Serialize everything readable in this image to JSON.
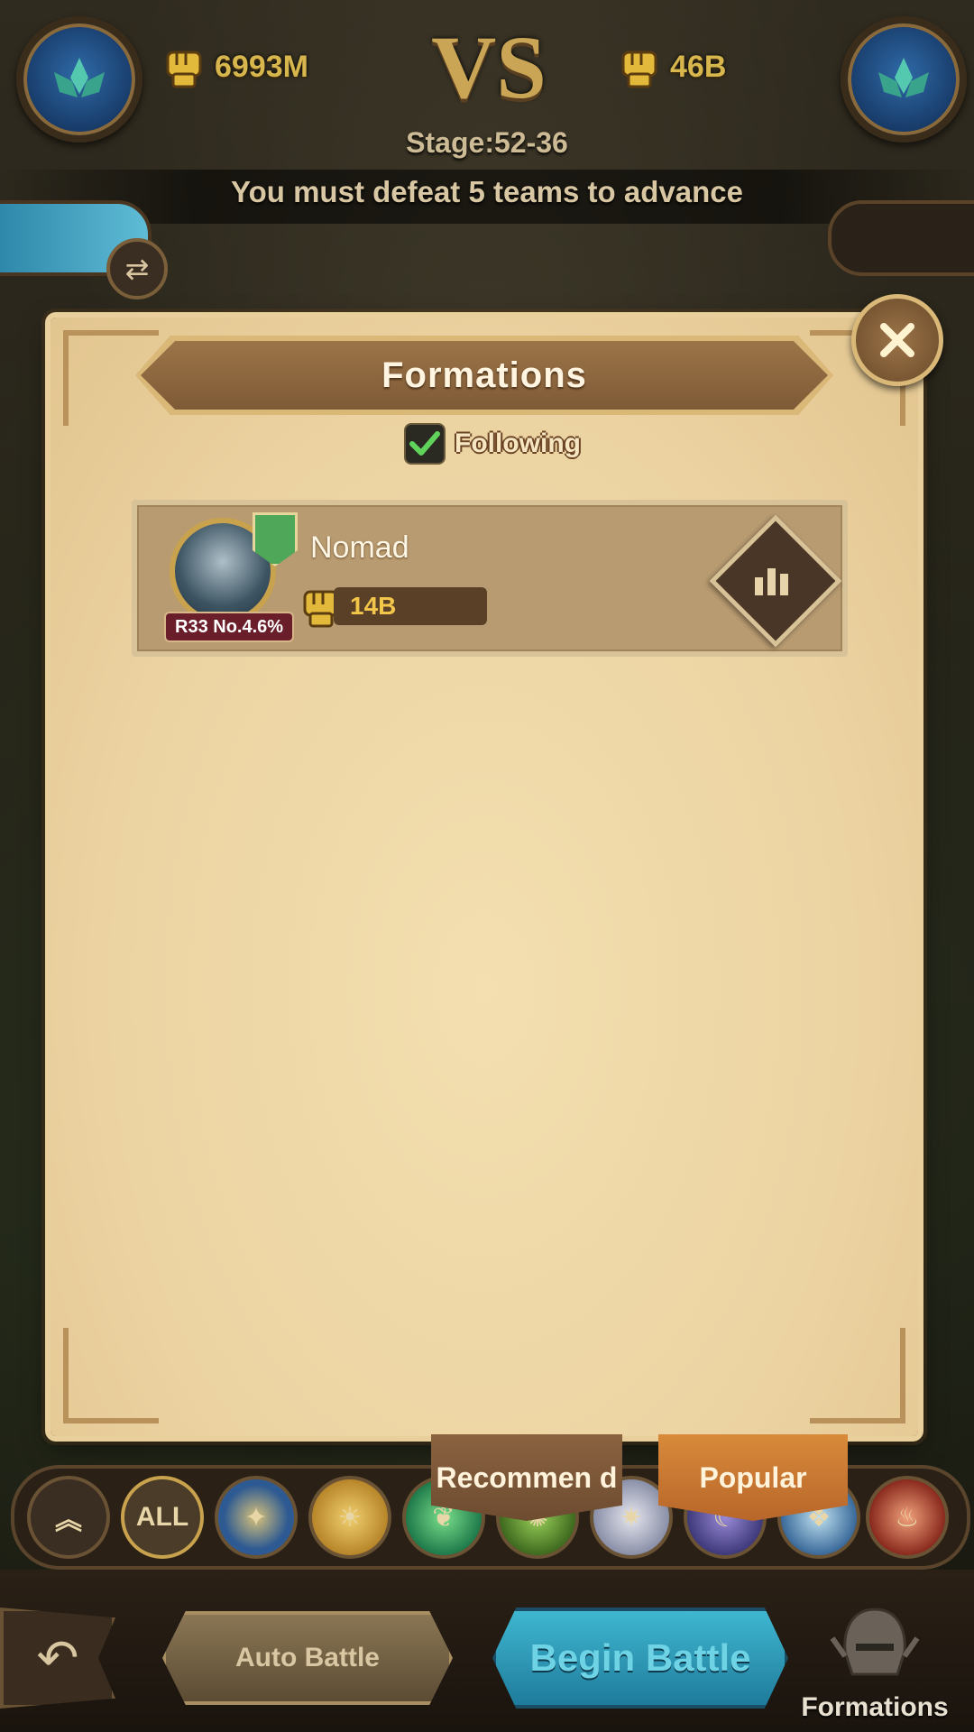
{
  "header": {
    "left_power": "6993M",
    "vs_label": "VS",
    "right_power": "46B",
    "stage": "Stage:52-36",
    "advance_message": "You must defeat 5 teams to advance"
  },
  "modal": {
    "title": "Formations",
    "following_label": "Following",
    "following_checked": true,
    "entries": [
      {
        "name": "Nomad",
        "power": "14B",
        "rank_tag": "R33 No.4.6%"
      }
    ]
  },
  "faction_filter": {
    "all_label": "ALL"
  },
  "tabs": {
    "recommend": "Recommen d",
    "popular": "Popular"
  },
  "bottom": {
    "auto_battle": "Auto Battle",
    "begin_battle": "Begin Battle",
    "formations": "Formations"
  },
  "colors": {
    "parchment": "#ecd3a2",
    "banner_brown": "#8a6240",
    "gold": "#d8b64e",
    "battle_cyan": "#2c9bb8",
    "popular_orange": "#c8742e"
  }
}
